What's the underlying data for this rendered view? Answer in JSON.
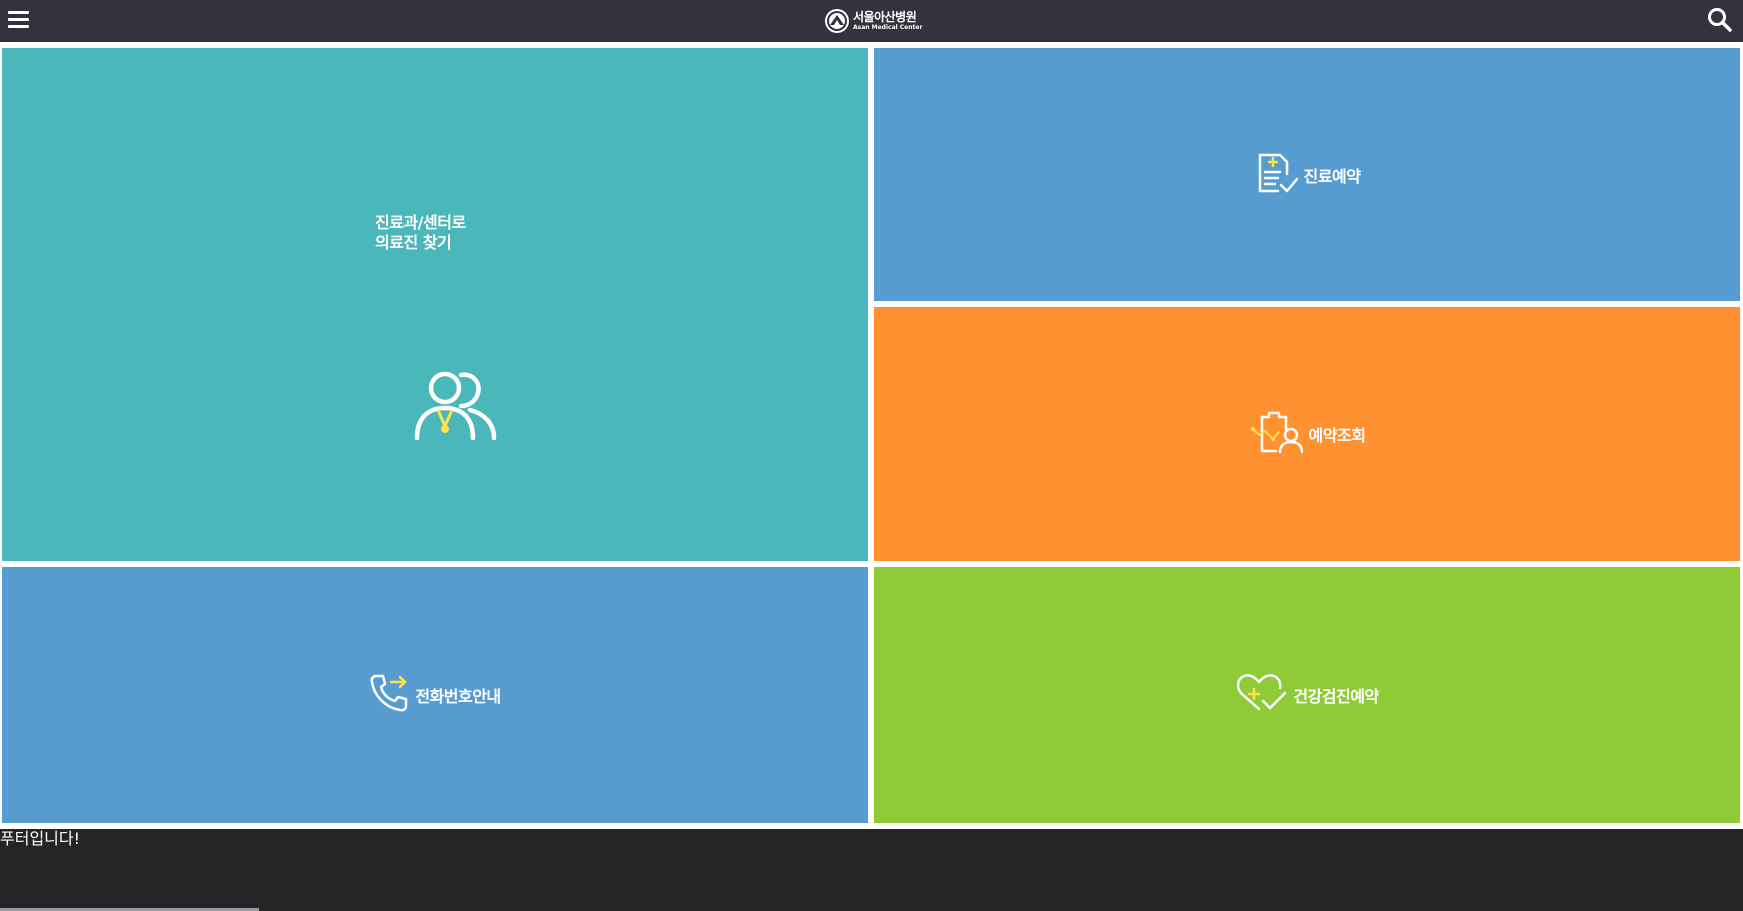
{
  "header": {
    "menu_icon": "hamburger-menu-icon",
    "logo_ko": "서울아산병원",
    "logo_en": "Asan Medical Center",
    "search_icon": "search-icon"
  },
  "tiles": {
    "find": {
      "title": "진료과/센터로\n의료진 찾기",
      "icon": "doctors-icon",
      "color": "#4ab7bb"
    },
    "reserve": {
      "label": "진료예약",
      "icon": "clipboard-check-icon",
      "color": "#569cd1"
    },
    "check": {
      "label": "예약조회",
      "icon": "clipboard-person-icon",
      "color": "#ff9130"
    },
    "phone": {
      "label": "전화번호안내",
      "icon": "phone-forward-icon",
      "color": "#569cd1"
    },
    "health": {
      "label": "건강검진예약",
      "icon": "heart-check-icon",
      "color": "#8fcb36"
    }
  },
  "footer": {
    "text": "푸터입니다!"
  },
  "colors": {
    "header_bg": "#32333d",
    "footer_bg": "#252528",
    "accent_yellow": "#ffe14a"
  }
}
